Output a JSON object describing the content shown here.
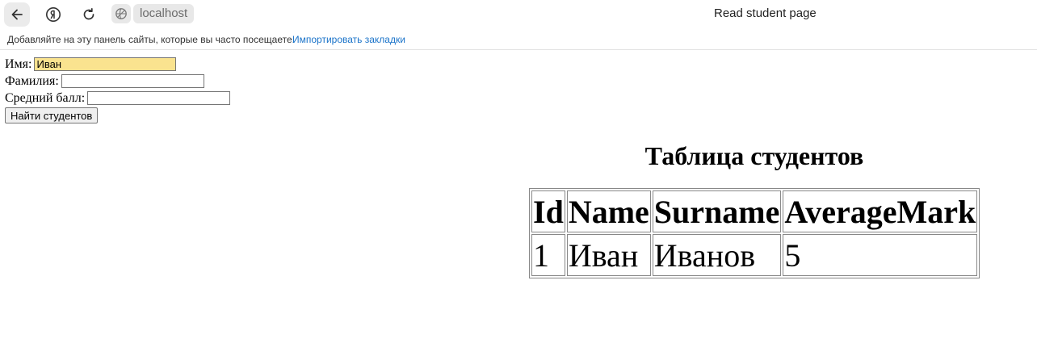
{
  "browser": {
    "url": "localhost",
    "tab_title": "Read student page",
    "bookmarks_hint": "Добавляйте на эту панель сайты, которые вы часто посещаете.",
    "import_bookmarks": "Импортировать закладки"
  },
  "form": {
    "name_label": "Имя:",
    "name_value": "Иван",
    "surname_label": "Фамилия:",
    "surname_value": "",
    "mark_label": "Средний балл:",
    "mark_value": "",
    "submit_label": "Найти студентов"
  },
  "table": {
    "title": "Таблица студентов",
    "columns": [
      "Id",
      "Name",
      "Surname",
      "AverageMark"
    ],
    "rows": [
      [
        "1",
        "Иван",
        "Иванов",
        "5"
      ]
    ]
  }
}
